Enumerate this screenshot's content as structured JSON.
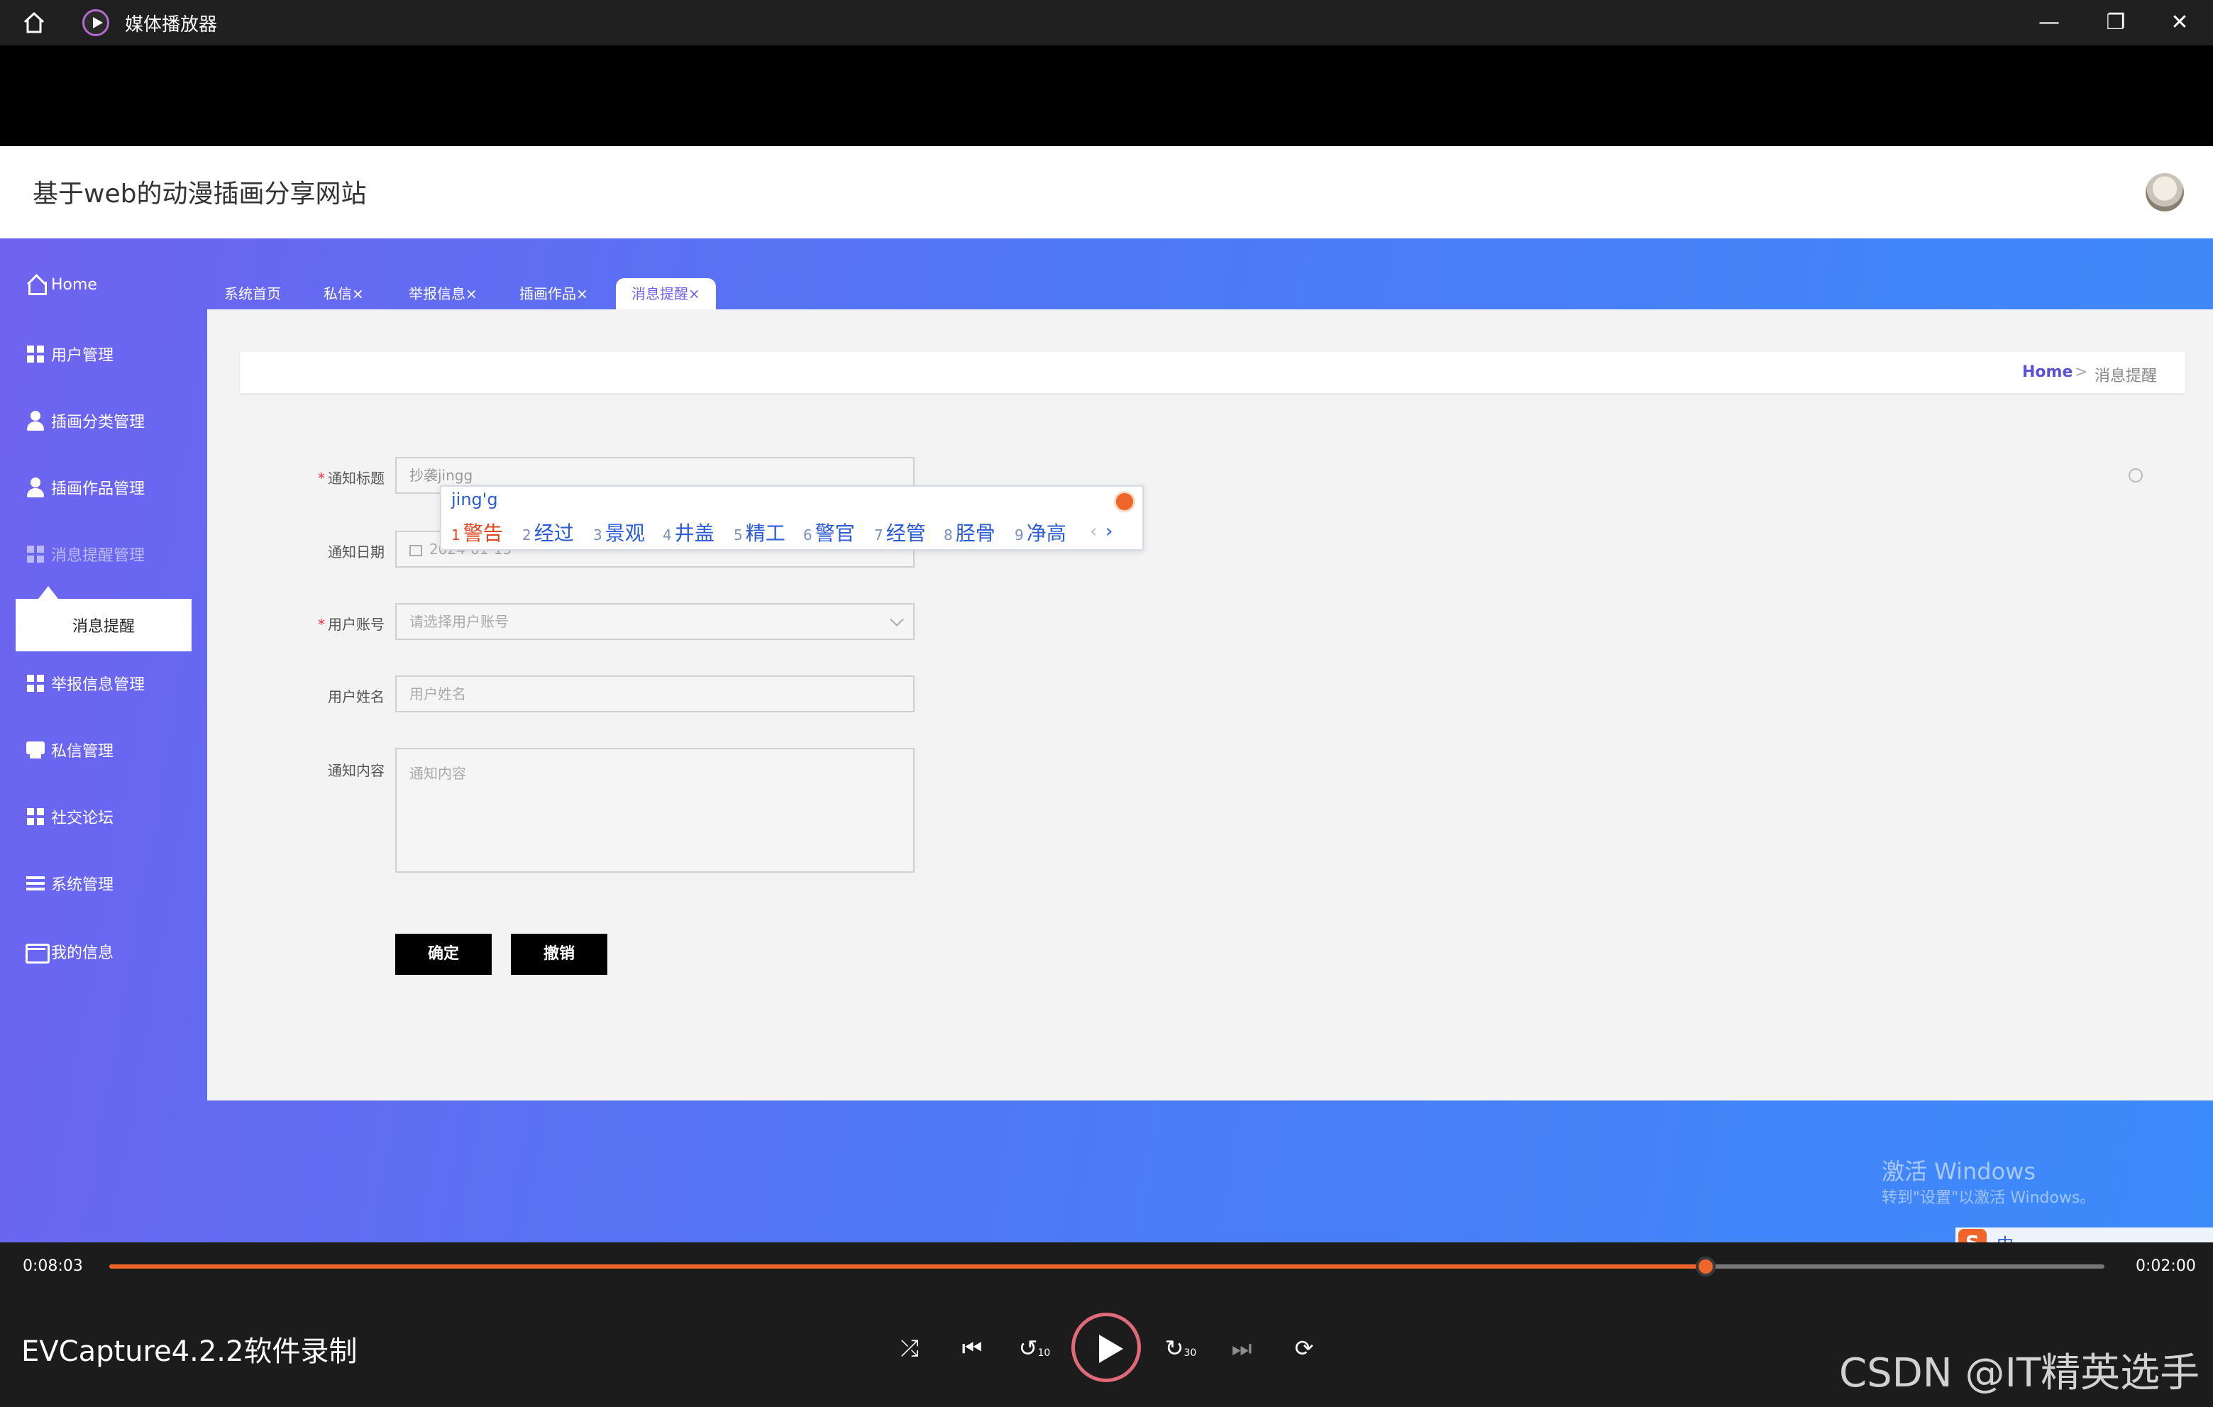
{
  "player": {
    "app_title": "媒体播放器",
    "window_controls": {
      "minimize": "—",
      "restore": "❐",
      "close": "✕"
    },
    "current_time": "0:08:03",
    "total_time": "0:02:00",
    "progress_fraction": 0.8,
    "recorder_label": "EVCapture4.2.2软件录制",
    "watermark_csdn": "CSDN @IT精英选手",
    "controls": {
      "shuffle": "⤮",
      "prev": "⏮",
      "rewind": "↺",
      "forward": "↻",
      "next": "⏭",
      "repeat": "⟳",
      "rewind_seconds": "10",
      "forward_seconds": "30"
    },
    "accent_color": "#f0662a"
  },
  "site": {
    "title": "基于web的动漫插画分享网站"
  },
  "sidebar": {
    "home": "Home",
    "items": [
      {
        "label": "用户管理",
        "icon": "grid-icon"
      },
      {
        "label": "插画分类管理",
        "icon": "user-icon"
      },
      {
        "label": "插画作品管理",
        "icon": "user-icon"
      },
      {
        "label": "消息提醒管理",
        "icon": "grid-icon"
      },
      {
        "label": "举报信息管理",
        "icon": "grid-icon"
      },
      {
        "label": "私信管理",
        "icon": "chat-icon"
      },
      {
        "label": "社交论坛",
        "icon": "grid-icon"
      },
      {
        "label": "系统管理",
        "icon": "list-icon"
      },
      {
        "label": "我的信息",
        "icon": "card-icon"
      }
    ],
    "sub_item": "消息提醒"
  },
  "tabs": [
    {
      "label": "系统首页"
    },
    {
      "label": "私信×"
    },
    {
      "label": "举报信息×"
    },
    {
      "label": "插画作品×"
    },
    {
      "label": "消息提醒×",
      "active": true
    }
  ],
  "breadcrumb": {
    "home": "Home",
    "sep": ">",
    "current": "消息提醒"
  },
  "form": {
    "title_label": "通知标题",
    "title_value": "抄袭jingg",
    "date_label": "通知日期",
    "date_value": "2024-01-15",
    "account_label": "用户账号",
    "account_placeholder": "请选择用户账号",
    "name_label": "用户姓名",
    "name_placeholder": "用户姓名",
    "content_label": "通知内容",
    "content_placeholder": "通知内容",
    "required_mark": "*",
    "confirm": "确定",
    "cancel": "撤销"
  },
  "ime": {
    "composition": "jing'g",
    "candidates": [
      {
        "n": "1",
        "w": "警告"
      },
      {
        "n": "2",
        "w": "经过"
      },
      {
        "n": "3",
        "w": "景观"
      },
      {
        "n": "4",
        "w": "井盖"
      },
      {
        "n": "5",
        "w": "精工"
      },
      {
        "n": "6",
        "w": "警官"
      },
      {
        "n": "7",
        "w": "经管"
      },
      {
        "n": "8",
        "w": "胫骨"
      },
      {
        "n": "9",
        "w": "净高"
      }
    ],
    "prev": "‹",
    "next": "›"
  },
  "os": {
    "activate_title": "激活 Windows",
    "activate_hint": "转到\"设置\"以激活 Windows。",
    "tray_lang": "中",
    "tray_s": "S"
  }
}
